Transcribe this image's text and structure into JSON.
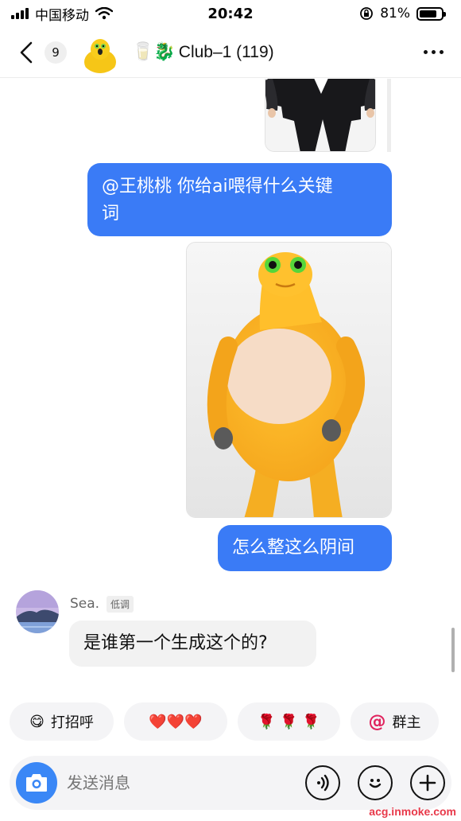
{
  "status_bar": {
    "carrier": "中国移动",
    "time": "20:42",
    "battery_pct": "81%",
    "battery_level": 0.81
  },
  "header": {
    "back_icon": "chevron-left-icon",
    "unread_count": "9",
    "title_emojis": "🥛🐉",
    "title": "Club–1 (119)",
    "more_icon": "more-horizontal-icon"
  },
  "messages": [
    {
      "type": "image",
      "from": "me",
      "subject": "man-in-suit"
    },
    {
      "type": "text",
      "from": "me",
      "mention": "@王桃桃",
      "text_line1": " 你给ai喂得什么关键",
      "text_line2": "词"
    },
    {
      "type": "image",
      "from": "me",
      "subject": "yellow-duck-creature"
    },
    {
      "type": "text",
      "from": "me",
      "text": "怎么整这么阴间"
    },
    {
      "type": "text",
      "from": "other",
      "sender": "Sea.",
      "role": "低调",
      "text": "是谁第一个生成这个的?"
    }
  ],
  "quick_replies": [
    {
      "icon": "smile-emoji",
      "emoji": "😋",
      "label": "打招呼"
    },
    {
      "label": "❤️❤️❤️"
    },
    {
      "label": "🌹 🌹 🌹"
    },
    {
      "icon": "at-icon",
      "at": "@",
      "label": "群主"
    }
  ],
  "input": {
    "placeholder": "发送消息"
  },
  "watermark": "acg.inmoke.com",
  "colors": {
    "bubble_blue": "#3a7bf6",
    "camera_blue": "#3a87f6",
    "background": "#ffffff"
  }
}
